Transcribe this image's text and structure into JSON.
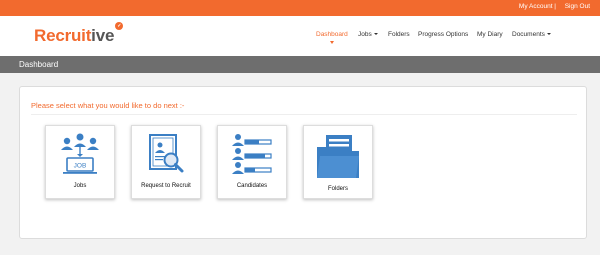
{
  "topbar": {
    "my_account": "My Account |",
    "sign_out": "Sign Out"
  },
  "logo": {
    "part1": "Recruit",
    "part2": "ive"
  },
  "nav": {
    "dashboard": "Dashboard",
    "jobs": "Jobs",
    "folders": "Folders",
    "progress_options": "Progress Options",
    "my_diary": "My Diary",
    "documents": "Documents"
  },
  "section": {
    "title": "Dashboard"
  },
  "main": {
    "prompt": "Please select what you would like to do next :-",
    "tiles": [
      {
        "label": "Jobs",
        "icon": "people-job-icon"
      },
      {
        "label": "Request to Recruit",
        "icon": "document-search-icon"
      },
      {
        "label": "Candidates",
        "icon": "candidates-list-icon"
      },
      {
        "label": "Folders",
        "icon": "folder-icon"
      }
    ]
  },
  "colors": {
    "accent": "#f26a2e",
    "icon": "#3b7fc4",
    "section_bar": "#6e6e6e"
  }
}
